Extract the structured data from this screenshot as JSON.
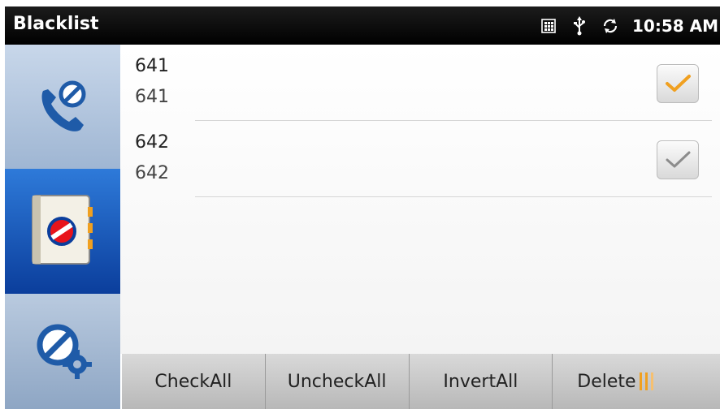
{
  "statusbar": {
    "title": "Blacklist",
    "time": "10:58 AM",
    "icons": [
      "keypad-icon",
      "usb-icon",
      "sync-icon"
    ]
  },
  "sidebar": {
    "items": [
      {
        "name": "blocked-call",
        "icon": "phone-blocked-icon",
        "selected": false
      },
      {
        "name": "blocked-contacts",
        "icon": "contacts-blocked-icon",
        "selected": true
      },
      {
        "name": "block-settings",
        "icon": "block-settings-icon",
        "selected": false
      }
    ]
  },
  "list": {
    "items": [
      {
        "name": "641",
        "number": "641",
        "checked": true
      },
      {
        "name": "642",
        "number": "642",
        "checked": false
      }
    ]
  },
  "bottombar": {
    "check_all": "CheckAll",
    "uncheck_all": "UncheckAll",
    "invert_all": "InvertAll",
    "delete": "Delete"
  },
  "colors": {
    "check_accent": "#f0a020",
    "check_gray": "#8c8c8c",
    "sidebar_selected": "#0b3e9c"
  }
}
